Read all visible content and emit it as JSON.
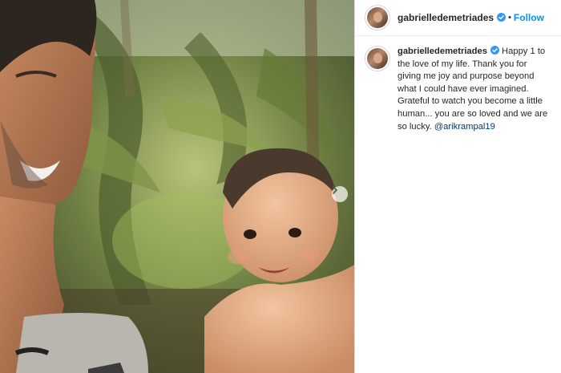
{
  "post": {
    "username": "gabrielledemetriades",
    "follow_label": "Follow",
    "separator": "•",
    "caption_text": "Happy 1 to the love of my life. Thank you for giving me joy and purpose beyond what I could have ever imagined. Grateful to watch you become a little human... you are so loved and we are so lucky.",
    "mention": "@arikrampal19"
  },
  "colors": {
    "accent": "#0095f6",
    "verified": "#3897f0",
    "mention": "#00376b"
  },
  "icons": {
    "verified": "verified-badge-icon",
    "carousel_next": "chevron-right-icon"
  }
}
